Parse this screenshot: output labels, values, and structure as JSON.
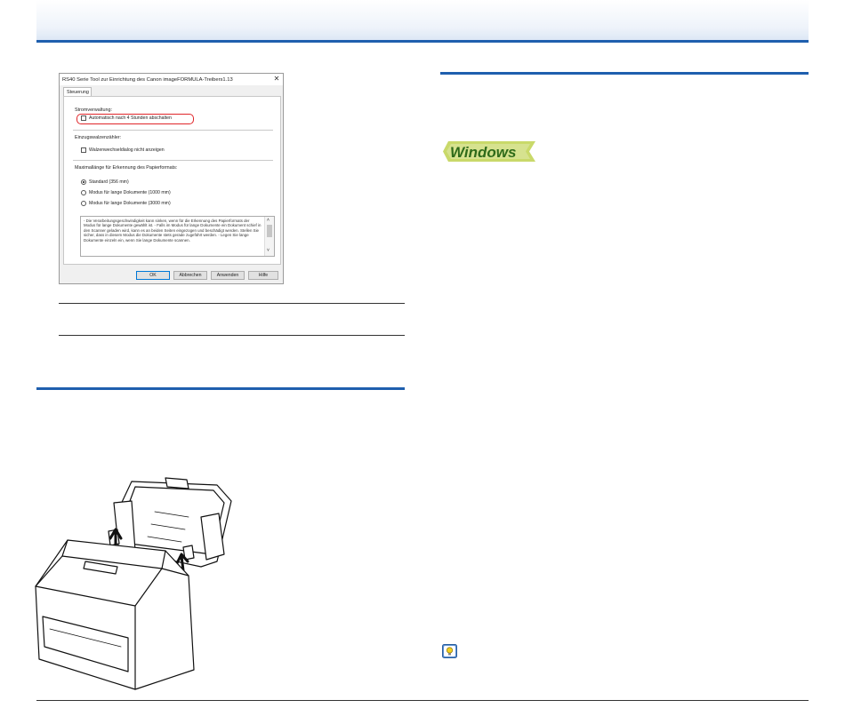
{
  "dialog": {
    "title": "RS40 Serie Tool zur Einrichtung des Canon imageFORMULA-Treibers1.13",
    "close_glyph": "✕",
    "tab": "Steuerung",
    "power_group": "Stromverwaltung:",
    "auto_off_option": "Automatisch nach 4 Stunden abschalten",
    "auto_off_checked": false,
    "roller_group": "Einzugswalzenzähler:",
    "roller_option": "Walzenwechseldialog nicht anzeigen",
    "roller_checked": false,
    "paper_group": "Maximallänge für Erkennung des Papierformats:",
    "paper_options": [
      "Standard (356 mm)",
      "Modus für lange Dokumente (1000 mm)",
      "Modus für lange Dokumente (3000 mm)"
    ],
    "paper_selected": "Standard (356 mm)",
    "info_text": "- Die Verarbeitungsgeschwindigkeit kann sinken, wenn für die Erkennung des Papierformats der Modus für lange Dokumente gewählt ist.\n- Falls im Modus für lange Dokumente ein Dokument schief in den Scanner geladen wird, kann es an beiden Seiten eingezogen und beschädigt werden. Stellen Sie sicher, dass in diesem Modus die Dokumente stets gerade zugeführt werden.\n- Legen Sie lange Dokumente einzeln ein, wenn Sie lange Dokumente scannen.",
    "buttons": {
      "ok": "OK",
      "cancel": "Abbrechen",
      "apply": "Anwenden",
      "help": "Hilfe"
    }
  },
  "logo": {
    "text": "Windows"
  },
  "colors": {
    "accent_blue": "#1f5fae",
    "highlight_red": "#e0262a",
    "logo_green": "#6a8f1f",
    "logo_bg": "#c9d96a"
  },
  "icons": [
    "scanner-illustration",
    "up-arrow-icon",
    "hint-lightbulb-icon"
  ]
}
